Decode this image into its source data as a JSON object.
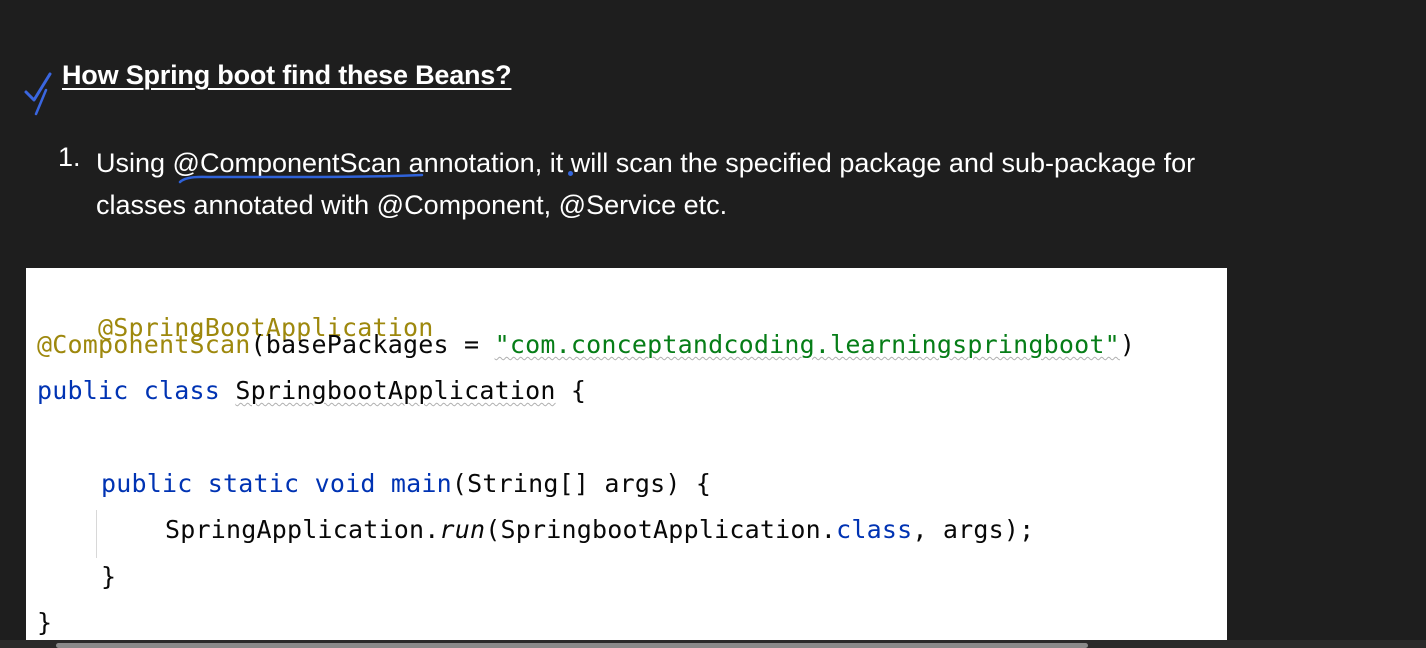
{
  "heading": "How Spring boot find these Beans?",
  "list": {
    "number": "1.",
    "line1": {
      "prefix": "Using ",
      "annotation": "@ComponentScan",
      "suffix": " annotation, it will scan the specified package and sub-package for"
    },
    "line2": "classes annotated with @Component, @Service etc."
  },
  "code": {
    "line1": "@SpringBootApplication",
    "line2": {
      "annotation": "@ComponentScan",
      "open": "(basePackages = ",
      "string": "\"com.conceptandcoding.learningspringboot\"",
      "close": ")"
    },
    "line3": {
      "kw1": "public",
      "kw2": "class",
      "name": "SpringbootApplication",
      "brace": " {"
    },
    "line5": {
      "kw1": "public",
      "kw2": "static",
      "kw3": "void",
      "method": "main",
      "params": "(String[] args) {"
    },
    "line6": {
      "obj": "SpringApplication.",
      "method": "run",
      "arg": "(SpringbootApplication.",
      "kw": "class",
      "rest": ", args);"
    },
    "line7": "}",
    "line8": "}"
  },
  "colors": {
    "background": "#1e1e1e",
    "annotation": "#9e880d",
    "keyword": "#0033b3",
    "string": "#067d17",
    "ink": "#3366dd"
  }
}
